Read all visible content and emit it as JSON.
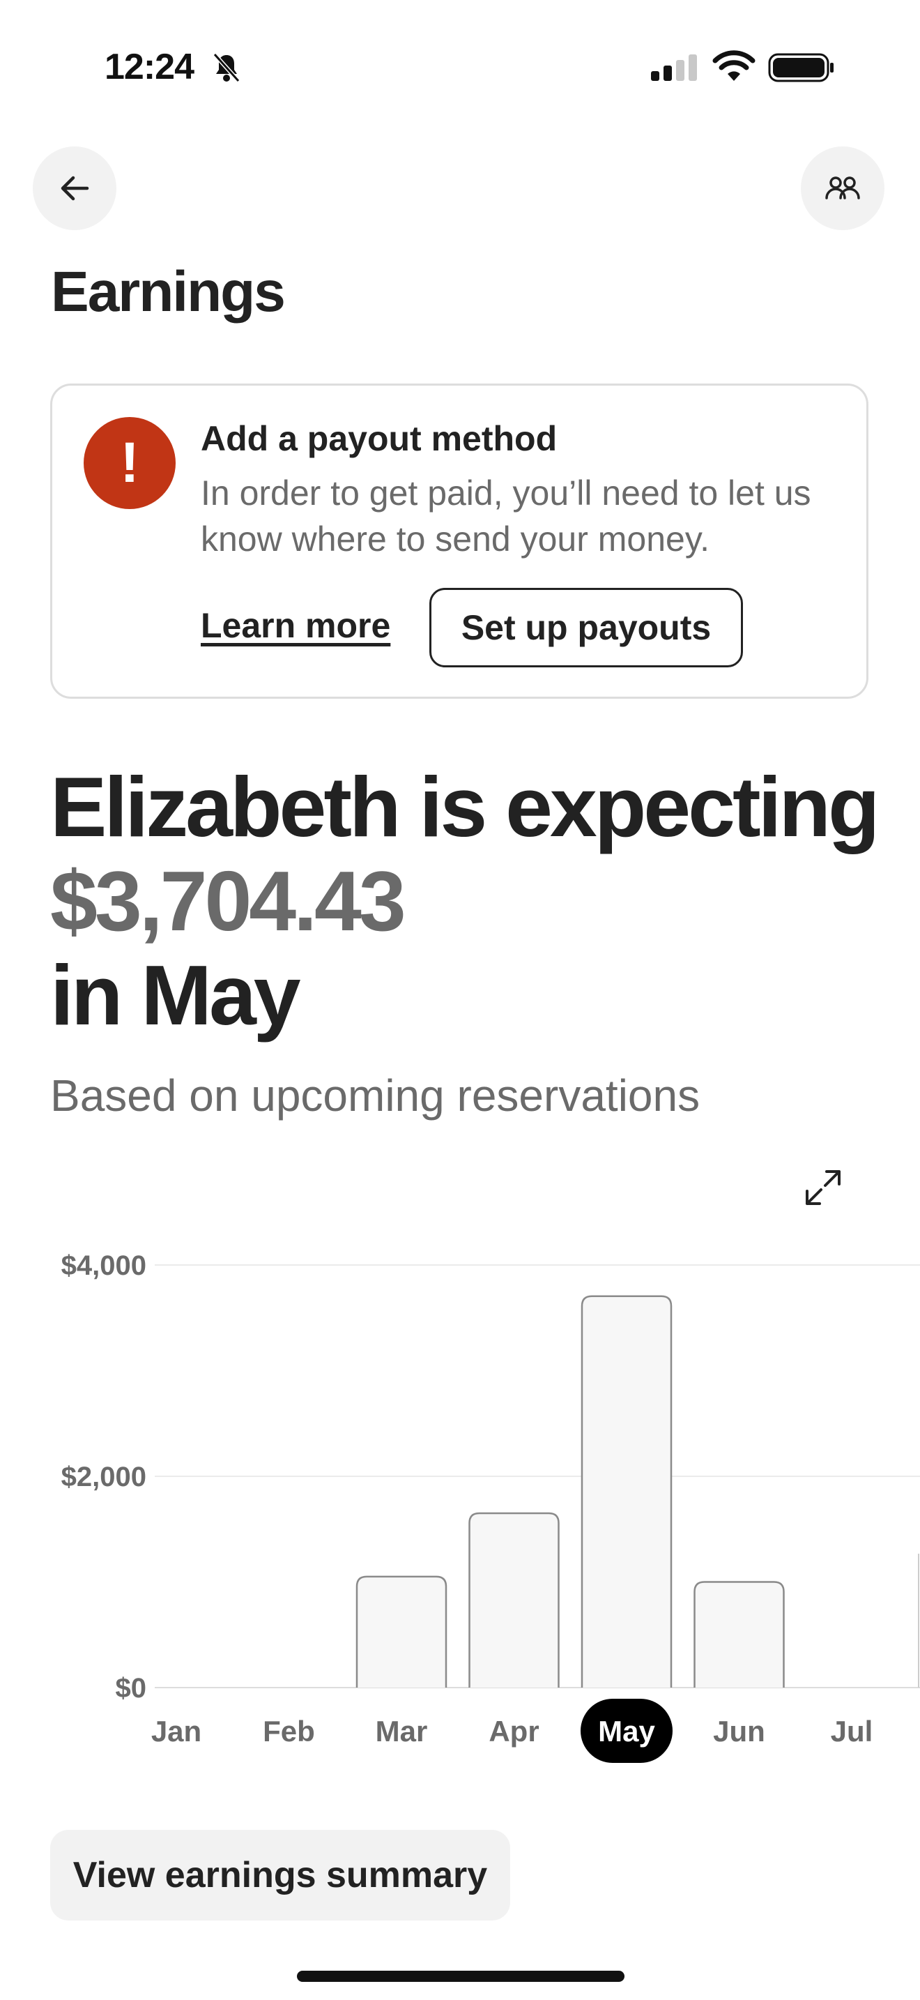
{
  "status_bar": {
    "time": "12:24",
    "icons": [
      "bell-off-icon",
      "cellular-signal-icon",
      "wifi-icon",
      "battery-icon"
    ]
  },
  "header": {
    "back_icon": "arrow-left-icon",
    "people_icon": "people-icon",
    "title": "Earnings"
  },
  "payout_card": {
    "icon": "exclamation-icon",
    "icon_glyph": "!",
    "title": "Add a payout method",
    "body": "In order to get paid, you’ll need to let us know where to send your money.",
    "learn_more_label": "Learn more",
    "setup_label": "Set up payouts",
    "accent_color": "#c13515"
  },
  "summary": {
    "line1": "Elizabeth is expecting",
    "amount": "$3,704.43",
    "line3": "in May",
    "subtitle": "Based on upcoming reservations"
  },
  "chart_data": {
    "type": "bar",
    "categories": [
      "Jan",
      "Feb",
      "Mar",
      "Apr",
      "May",
      "Jun",
      "Jul"
    ],
    "values": [
      0,
      0,
      1050,
      1650,
      3704.43,
      1000,
      0
    ],
    "selected": "May",
    "ylim": [
      0,
      4000
    ],
    "y_ticks": [
      {
        "value": 4000,
        "label": "$4,000"
      },
      {
        "value": 2000,
        "label": "$2,000"
      },
      {
        "value": 0,
        "label": "$0"
      }
    ],
    "grid": true,
    "title": "",
    "xlabel": "",
    "ylabel": ""
  },
  "actions": {
    "expand_icon": "expand-icon",
    "view_summary_label": "View earnings summary"
  }
}
